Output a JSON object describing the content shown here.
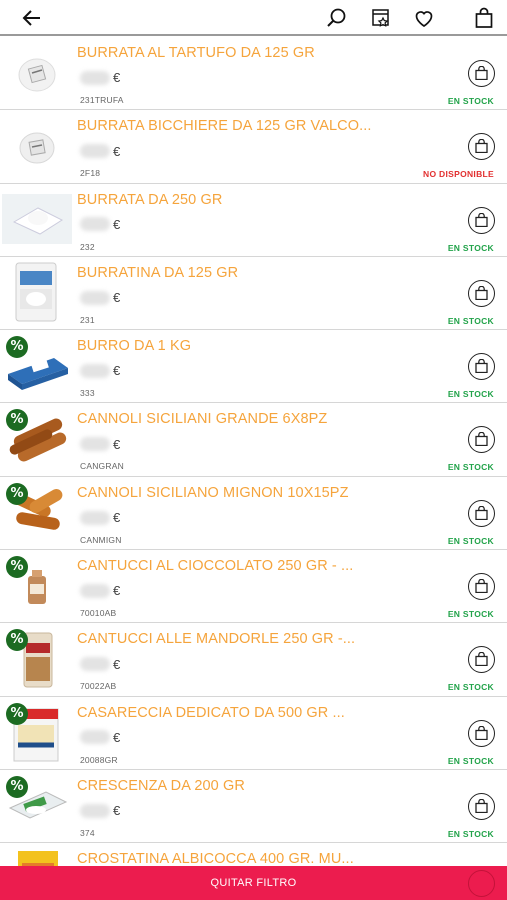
{
  "header": {
    "icons": [
      "back-arrow-icon",
      "search-icon",
      "catalog-star-icon",
      "heart-icon",
      "shopping-bag-icon"
    ]
  },
  "currency": "€",
  "products": [
    {
      "name": "BURRATA AL TARTUFO DA 125 GR",
      "code": "231TRUFA",
      "stock": "EN STOCK",
      "available": true,
      "promo": false
    },
    {
      "name": "BURRATA BICCHIERE DA 125 GR VALCO...",
      "code": "2F18",
      "stock": "NO DISPONIBLE",
      "available": false,
      "promo": false
    },
    {
      "name": "BURRATA DA 250 GR",
      "code": "232",
      "stock": "EN STOCK",
      "available": true,
      "promo": false
    },
    {
      "name": "BURRATINA DA 125 GR",
      "code": "231",
      "stock": "EN STOCK",
      "available": true,
      "promo": false
    },
    {
      "name": "BURRO DA 1 KG",
      "code": "333",
      "stock": "EN STOCK",
      "available": true,
      "promo": true
    },
    {
      "name": "CANNOLI SICILIANI GRANDE 6X8PZ",
      "code": "CANGRAN",
      "stock": "EN STOCK",
      "available": true,
      "promo": true
    },
    {
      "name": "CANNOLI SICILIANO MIGNON 10X15PZ",
      "code": "CANMIGN",
      "stock": "EN STOCK",
      "available": true,
      "promo": true
    },
    {
      "name": "CANTUCCI AL CIOCCOLATO 250 GR - ...",
      "code": "70010AB",
      "stock": "EN STOCK",
      "available": true,
      "promo": true
    },
    {
      "name": "CANTUCCI ALLE MANDORLE 250 GR -...",
      "code": "70022AB",
      "stock": "EN STOCK",
      "available": true,
      "promo": true
    },
    {
      "name": "CASARECCIA DEDICATO DA 500 GR ...",
      "code": "20088GR",
      "stock": "EN STOCK",
      "available": true,
      "promo": true
    },
    {
      "name": "CRESCENZA DA 200 GR",
      "code": "374",
      "stock": "EN STOCK",
      "available": true,
      "promo": true
    },
    {
      "name": "CROSTATINA ALBICOCCA 400 GR. MU...",
      "code": "",
      "stock": "",
      "available": true,
      "promo": false
    }
  ],
  "promo_badge": "%",
  "footer": {
    "filter_button": "QUITAR FILTRO"
  },
  "colors": {
    "product_name": "#f5a43c",
    "in_stock": "#22a34a",
    "not_available": "#e23030",
    "footer_bg": "#ec1c4e",
    "promo_badge": "#1c6b22"
  }
}
